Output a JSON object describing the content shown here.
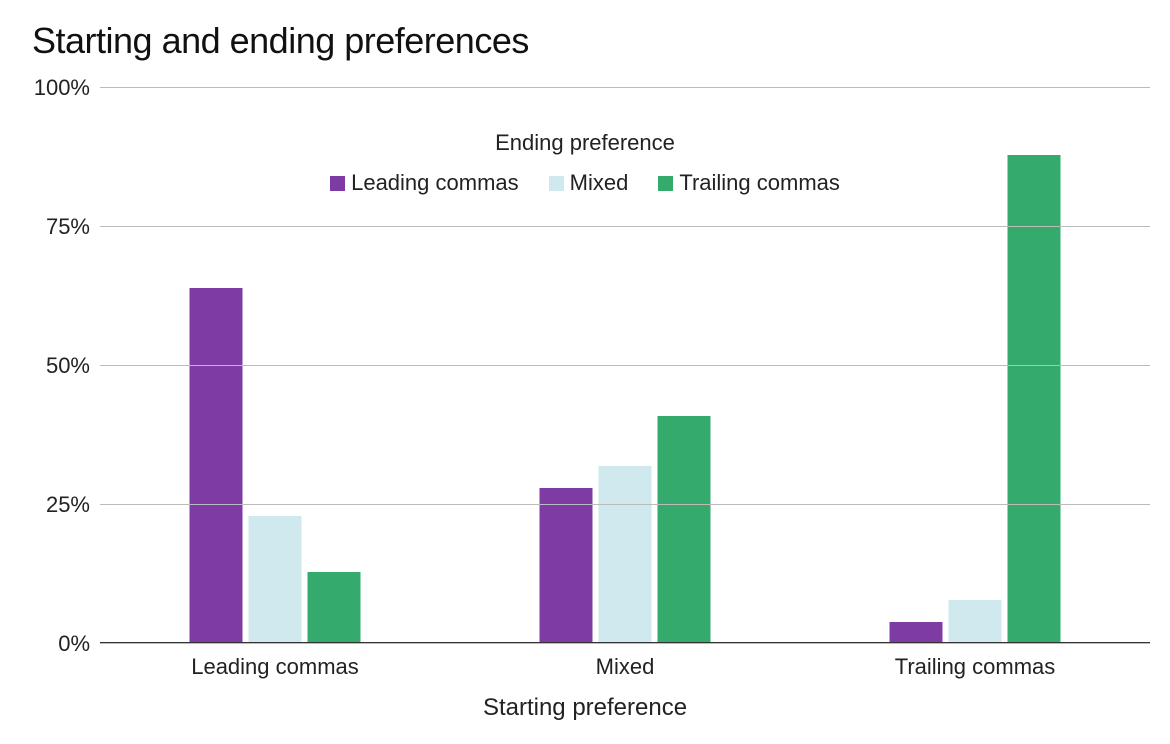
{
  "chart_data": {
    "type": "bar",
    "title": "Starting and ending preferences",
    "xlabel": "Starting preference",
    "ylabel": "",
    "ylim": [
      0,
      100
    ],
    "yticks": [
      0,
      25,
      50,
      75,
      100
    ],
    "ytick_labels": [
      "0%",
      "25%",
      "50%",
      "75%",
      "100%"
    ],
    "legend_title": "Ending preference",
    "categories": [
      "Leading commas",
      "Mixed",
      "Trailing commas"
    ],
    "series": [
      {
        "name": "Leading commas",
        "color": "#7e3ba3",
        "values": [
          64,
          28,
          4
        ]
      },
      {
        "name": "Mixed",
        "color": "#cfe9ee",
        "values": [
          23,
          32,
          8
        ]
      },
      {
        "name": "Trailing commas",
        "color": "#34aa6c",
        "values": [
          13,
          41,
          88
        ]
      }
    ]
  }
}
